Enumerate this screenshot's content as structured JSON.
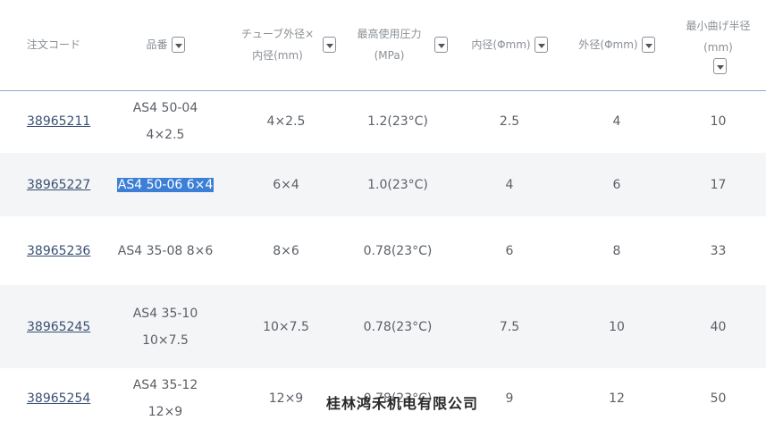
{
  "columns": [
    {
      "label": "注文コード",
      "filter": false
    },
    {
      "label": "品番",
      "filter": true
    },
    {
      "label": "チューブ外径×内径(mm)",
      "filter": true
    },
    {
      "label": "最高使用圧力(MPa)",
      "filter": true
    },
    {
      "label": "内径(Φmm)",
      "filter": true
    },
    {
      "label": "外径(Φmm)",
      "filter": true
    },
    {
      "label": "最小曲げ半径(mm)",
      "filter": true
    }
  ],
  "rows": [
    {
      "code": "38965211",
      "part": "AS4 50-04 4×2.5",
      "size": "4×2.5",
      "pressure": "1.2(23°C)",
      "id": "2.5",
      "od": "4",
      "radius": "10"
    },
    {
      "code": "38965227",
      "part": "AS4 50-06 6×4",
      "size": "6×4",
      "pressure": "1.0(23°C)",
      "id": "4",
      "od": "6",
      "radius": "17"
    },
    {
      "code": "38965236",
      "part": "AS4 35-08 8×6",
      "size": "8×6",
      "pressure": "0.78(23°C)",
      "id": "6",
      "od": "8",
      "radius": "33"
    },
    {
      "code": "38965245",
      "part": "AS4 35-10 10×7.5",
      "size": "10×7.5",
      "pressure": "0.78(23°C)",
      "id": "7.5",
      "od": "10",
      "radius": "40"
    },
    {
      "code": "38965254",
      "part": "AS4 35-12 12×9",
      "size": "12×9",
      "pressure": "0.78(23°C)",
      "id": "9",
      "od": "12",
      "radius": "50"
    }
  ],
  "watermark": "桂林鸿禾机电有限公司",
  "colors": {
    "link": "#3a4f73",
    "selection": "#3d7fd6",
    "header_border": "#8fa8c8"
  }
}
